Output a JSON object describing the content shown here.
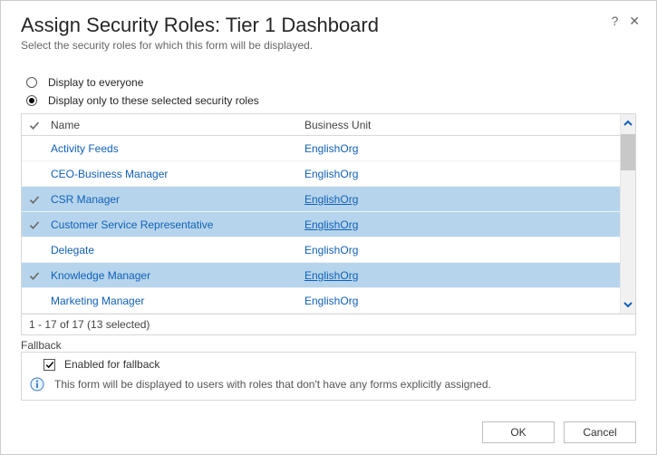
{
  "header": {
    "title": "Assign Security Roles: Tier 1 Dashboard",
    "subtitle": "Select the security roles for which this form will be displayed.",
    "help_tooltip": "?",
    "close_tooltip": "✕"
  },
  "options": {
    "everyone_label": "Display to everyone",
    "selected_label": "Display only to these selected security roles",
    "selected_option": "selected"
  },
  "grid": {
    "columns": {
      "name": "Name",
      "business_unit": "Business Unit"
    },
    "rows": [
      {
        "name": "Activity Feeds",
        "bu": "EnglishOrg",
        "selected": false
      },
      {
        "name": "CEO-Business Manager",
        "bu": "EnglishOrg",
        "selected": false
      },
      {
        "name": "CSR Manager",
        "bu": "EnglishOrg",
        "selected": true
      },
      {
        "name": "Customer Service Representative",
        "bu": "EnglishOrg",
        "selected": true
      },
      {
        "name": "Delegate",
        "bu": "EnglishOrg",
        "selected": false
      },
      {
        "name": "Knowledge Manager",
        "bu": "EnglishOrg",
        "selected": true
      },
      {
        "name": "Marketing Manager",
        "bu": "EnglishOrg",
        "selected": false
      }
    ],
    "footer": "1 - 17 of 17 (13 selected)"
  },
  "fallback": {
    "section_title": "Fallback",
    "checkbox_label": "Enabled for fallback",
    "checked": true,
    "info_text": "This form will be displayed to users with roles that don't have any forms explicitly assigned."
  },
  "buttons": {
    "ok": "OK",
    "cancel": "Cancel"
  }
}
